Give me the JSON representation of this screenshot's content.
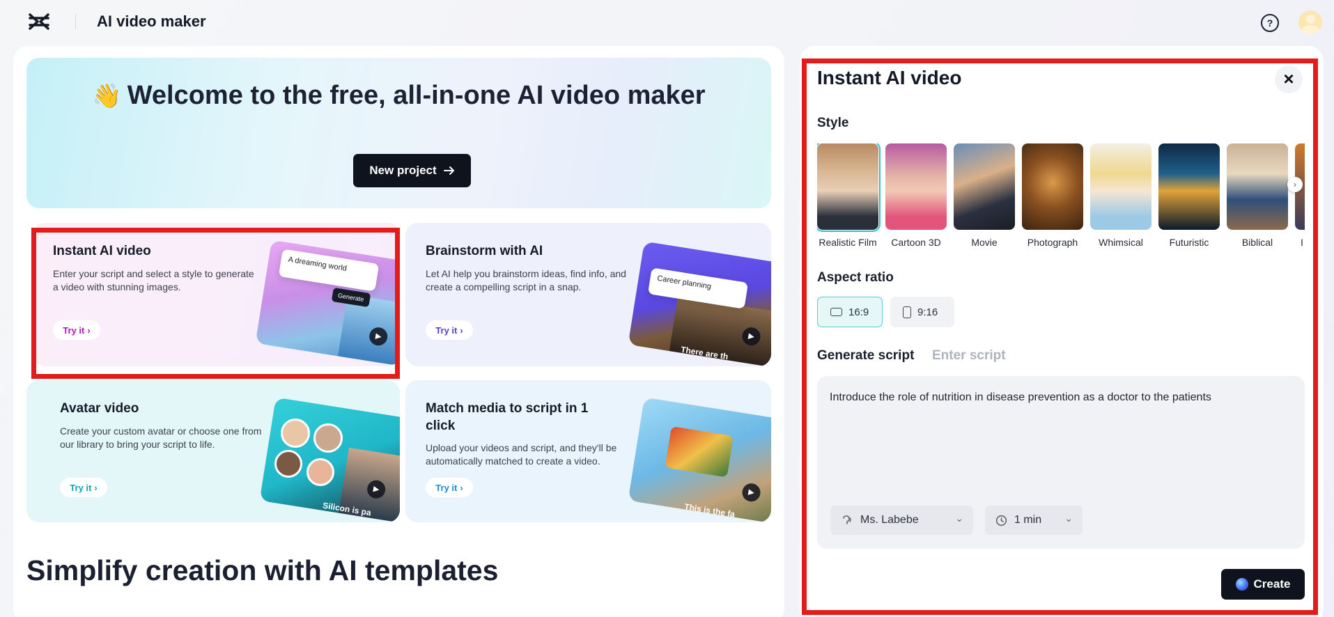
{
  "header": {
    "title": "AI video maker",
    "help_icon": "?"
  },
  "hero": {
    "emoji": "👋",
    "title": "Welcome to the free, all-in-one AI video maker",
    "new_project_label": "New project"
  },
  "cards": [
    {
      "title": "Instant AI video",
      "desc": "Enter your script and select a style to generate a video with stunning images.",
      "try_label": "Try it",
      "accent": "#b515b9",
      "preview_text": "A dreaming world",
      "preview_button": "Generate"
    },
    {
      "title": "Brainstorm with AI",
      "desc": "Let AI help you brainstorm ideas, find info, and create a compelling script in a snap.",
      "try_label": "Try it",
      "accent": "#5a3ae0",
      "preview_text": "Career planning",
      "preview_caption": "There are th"
    },
    {
      "title": "Avatar video",
      "desc": "Create your custom avatar or choose one from our library to bring your script to life.",
      "try_label": "Try it",
      "accent": "#0aa7b8",
      "preview_caption": "Silicon is pa"
    },
    {
      "title": "Match media to script in 1 click",
      "desc": "Upload your videos and script, and they'll be automatically matched to create a video.",
      "try_label": "Try it",
      "accent": "#1a8ad0",
      "preview_caption": "This is the fa"
    }
  ],
  "section_heading": "Simplify creation with AI templates",
  "panel": {
    "title": "Instant AI video",
    "style_label": "Style",
    "styles": [
      {
        "name": "Realistic Film",
        "selected": true
      },
      {
        "name": "Cartoon 3D"
      },
      {
        "name": "Movie"
      },
      {
        "name": "Photograph"
      },
      {
        "name": "Whimsical"
      },
      {
        "name": "Futuristic"
      },
      {
        "name": "Biblical"
      },
      {
        "name": "I"
      }
    ],
    "aspect_label": "Aspect ratio",
    "aspects": [
      {
        "label": "16:9",
        "selected": true
      },
      {
        "label": "9:16"
      }
    ],
    "tabs": {
      "active": "Generate script",
      "inactive": "Enter script"
    },
    "script": "Introduce the role of nutrition in disease prevention as a doctor to the patients",
    "voice": "Ms. Labebe",
    "duration": "1 min",
    "create_label": "Create"
  },
  "colors": {
    "highlight": "#e31b1b",
    "selected_outline": "#2dc1cf",
    "primary_button": "#0e131d"
  }
}
